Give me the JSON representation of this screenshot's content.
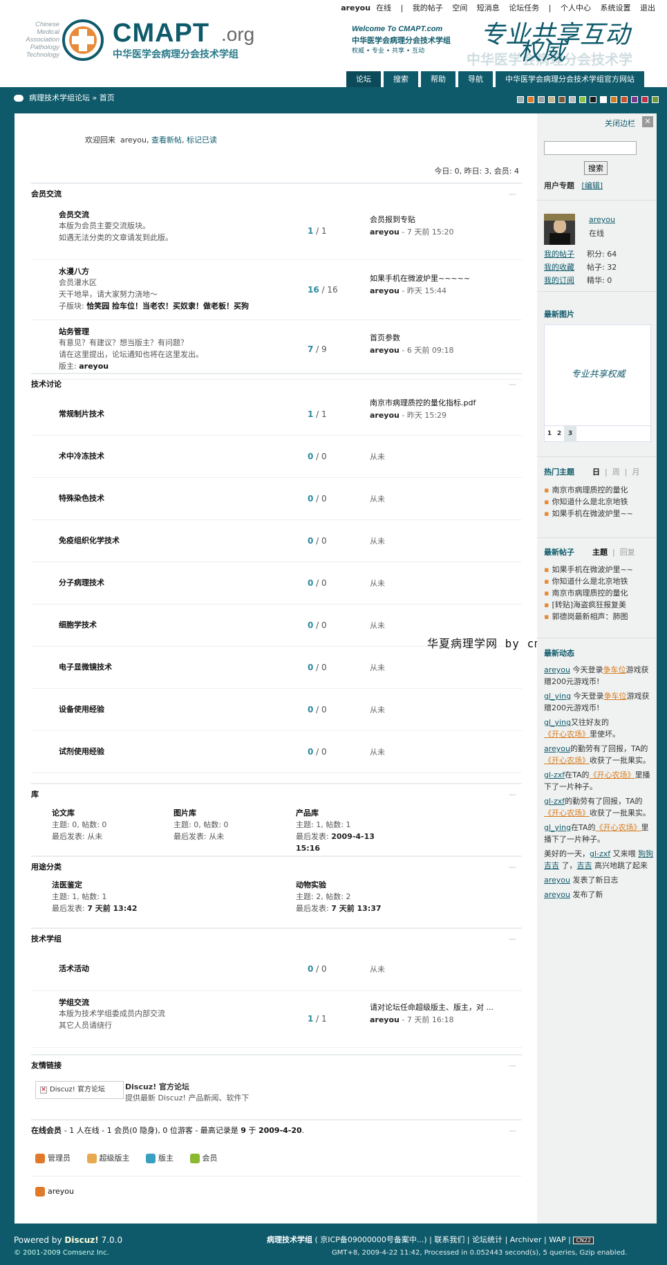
{
  "header": {
    "username": "areyou",
    "status": "在线",
    "sep": "|",
    "links": [
      "我的帖子",
      "空间",
      "短消息",
      "论坛任务",
      "个人中心",
      "系统设置",
      "退出"
    ],
    "logo_side": [
      "Chinese",
      "Medical",
      "Association",
      "Pathology",
      "Technology"
    ],
    "logo_big": "CMAPT",
    "logo_org": ".org",
    "logo_cn": "中华医学会病理分会技术学组",
    "banner_welcome": "Welcome To CMAPT.com",
    "banner_cn": "中华医学会病理分会技术学组",
    "banner_motto": "权威 • 专业 • 共享 • 互动",
    "banner_slogan1": "专业共享互动",
    "banner_slogan2": "权威",
    "banner_ghost": "中华医学会病理分会技术学"
  },
  "nav": {
    "tabs": [
      "论坛",
      "搜索",
      "帮助",
      "导航"
    ],
    "site": "中华医学会病理分会技术学组官方网站"
  },
  "crumb": {
    "forum": "病理技术学组论坛",
    "sep": "»",
    "home": "首页"
  },
  "swatch_colors": [
    "#9fb1b7",
    "#e07a2a",
    "#9aa0a3",
    "#c9b48a",
    "#7c5a3a",
    "#b8bcc0",
    "#8ac04a",
    "#1a1a1a",
    "#ffffff",
    "#d67a1e",
    "#c8532a",
    "#7a3a8a",
    "#c0304a",
    "#6a9a3a"
  ],
  "main": {
    "welcome_pre": "欢迎回来",
    "welcome_user": "areyou,",
    "welcome_new": "查看新帖",
    "welcome_read": "标记已读",
    "stats": "今日: 0, 昨日: 3, 会员: 4",
    "collapse": "—",
    "groups": {
      "g1": "会员交流",
      "g2": "技术讨论",
      "g3": "库",
      "g4": "用途分类",
      "g5": "技术学组",
      "g6": "友情链接"
    },
    "forums1": [
      {
        "name": "会员交流",
        "desc1": "本版为会员主要交流版块。",
        "desc2": "如遇无法分类的文章请发到此版。",
        "t": "1",
        "p": "1",
        "last_title": "会员报到专贴",
        "last_by": "areyou",
        "last_time": "- 7 天前 15:20"
      },
      {
        "name": "水漫八方",
        "desc1": "会员灌水区",
        "desc2": "天干地旱，请大家努力浇地～",
        "desc3": "子版块:",
        "subs": "恰笑园  捡车位！当老农！买奴隶！做老板！买狗",
        "t": "16",
        "p": "16",
        "last_title": "如果手机在微波炉里~~~~~",
        "last_by": "areyou",
        "last_time": "- 昨天 15:44"
      },
      {
        "name": "站务管理",
        "desc1": "有意见？有建议？想当版主？有问题？",
        "desc2": "请在这里提出，论坛通知也将在这里发出。",
        "mod_label": "版主:",
        "mod": "areyou",
        "t": "7",
        "p": "9",
        "last_title": "首页参数",
        "last_by": "areyou",
        "last_time": "- 6 天前 09:18"
      }
    ],
    "forums2": [
      {
        "name": "常规制片技术",
        "t": "1",
        "p": "1",
        "last_title": "南京市病理质控的量化指标.pdf",
        "last_by": "areyou",
        "last_time": "- 昨天 15:29"
      },
      {
        "name": "术中冷冻技术",
        "t": "0",
        "p": "0",
        "never": "从未"
      },
      {
        "name": "特殊染色技术",
        "t": "0",
        "p": "0",
        "never": "从未"
      },
      {
        "name": "免疫组织化学技术",
        "t": "0",
        "p": "0",
        "never": "从未"
      },
      {
        "name": "分子病理技术",
        "t": "0",
        "p": "0",
        "never": "从未"
      },
      {
        "name": "细胞学技术",
        "t": "0",
        "p": "0",
        "never": "从未"
      },
      {
        "name": "电子显微镜技术",
        "t": "0",
        "p": "0",
        "never": "从未"
      },
      {
        "name": "设备使用经验",
        "t": "0",
        "p": "0",
        "never": "从未"
      },
      {
        "name": "试剂使用经验",
        "t": "0",
        "p": "0",
        "never": "从未"
      }
    ],
    "libs": [
      {
        "name": "论文库",
        "stat": "主题: 0, 帖数: 0",
        "last": "最后发表: 从未"
      },
      {
        "name": "图片库",
        "stat": "主题: 0, 帖数: 0",
        "last": "最后发表: 从未"
      },
      {
        "name": "产品库",
        "stat": "主题: 1, 帖数: 1",
        "last_label": "最后发表:",
        "last_val": "2009-4-13",
        "last_val2": "15:16"
      }
    ],
    "uses": [
      {
        "name": "法医鉴定",
        "stat": "主题: 1, 帖数: 1",
        "last_label": "最后发表:",
        "last_val": "7 天前 13:42"
      },
      {
        "name": "动物实验",
        "stat": "主题: 2, 帖数: 2",
        "last_label": "最后发表:",
        "last_val": "7 天前 13:37"
      }
    ],
    "forums5": [
      {
        "name": "活术活动",
        "t": "0",
        "p": "0",
        "never": "从未"
      },
      {
        "name": "学组交流",
        "desc1": "本版为技术学组委成员内部交流",
        "desc2": "其它人员请绕行",
        "t": "1",
        "p": "1",
        "last_title": "请对论坛任命超级版主、版主，对 ...",
        "last_by": "areyou",
        "last_time": "- 7 天前 16:18"
      }
    ],
    "link": {
      "img_label": "Discuz! 官方论坛",
      "title": "Discuz! 官方论坛",
      "desc": "提供最新 Discuz! 产品新闻、软件下"
    },
    "online": {
      "label": "在线会员",
      "summary1": "- 1 人在线 - 1 会员(0 隐身), 0 位游客 - 最高记录是",
      "peak": "9",
      "summary2": "于",
      "peak_date": "2009-4-20",
      "summary3": ".",
      "legend": [
        "管理员",
        "超级版主",
        "版主",
        "会员"
      ],
      "legend_colors": [
        "#e07a2a",
        "#e8a850",
        "#3aa0c0",
        "#8ab830"
      ],
      "user": "areyou"
    }
  },
  "watermark": "华夏病理学网 by cmapt",
  "side": {
    "close": "关闭边栏",
    "close_x": "✕",
    "search_btn": "搜索",
    "topics_label": "用户专题",
    "topics_edit": "[编辑]",
    "user": "areyou",
    "user_status": "在线",
    "my_links": [
      "我的帖子",
      "我的收藏",
      "我的订阅"
    ],
    "user_stats": [
      "积分: 64",
      "帖子: 32",
      "精华: 0"
    ],
    "latest_img_title": "最新图片",
    "img_caption": "专业共享权威",
    "img_pages": [
      "1",
      "2",
      "3"
    ],
    "hot_title": "热门主题",
    "hot_tabs": [
      "日",
      "周",
      "月"
    ],
    "hot_list": [
      "南京市病理质控的量化",
      "你知道什么是北京地铁",
      "如果手机在微波炉里~~"
    ],
    "new_posts_title": "最新帖子",
    "new_posts_tabs": [
      "主题",
      "回复"
    ],
    "new_posts": [
      "如果手机在微波炉里~~",
      "你知道什么是北京地铁",
      "南京市病理质控的量化",
      "[转贴]海盗疯狂报复美",
      "郭德岗最新相声：肺图"
    ],
    "feed_title": "最新动态",
    "feed": [
      {
        "u": "areyou",
        "t1": " 今天登录",
        "l": "争车位",
        "t2": "游戏获赠200元游戏币!"
      },
      {
        "u": "gl_ying",
        "t1": " 今天登录",
        "l": "争车位",
        "t2": "游戏获赠200元游戏币!"
      },
      {
        "u": "gl_ying",
        "t1": "又往好友的",
        "l": "《开心农场》",
        "t2": "里使坏。"
      },
      {
        "u": "areyou",
        "t1": "的勤劳有了回报，TA的",
        "l": "《开心农场》",
        "t2": "收获了一批果实。"
      },
      {
        "u": "gl-zxf",
        "t1": "在TA的",
        "l": "《开心农场》",
        "t2": "里播下了一片种子。"
      },
      {
        "u": "gl-zxf",
        "t1": "的勤劳有了回报，TA的",
        "l": "《开心农场》",
        "t2": "收获了一批果实。"
      },
      {
        "u": "gl_ying",
        "t1": "在TA的",
        "l": "《开心农场》",
        "t2": "里播下了一片种子。"
      }
    ],
    "feed_pet": {
      "t1": "美好的一天，",
      "u": "gl-zxf",
      "t2": " 又来喂 ",
      "l1": "狗狗 吉吉",
      "t3": " 了，",
      "l2": "吉吉",
      "t4": " 高兴地跳了起来"
    },
    "feed_tail": [
      {
        "u": "areyou",
        "t": " 发表了新日志"
      },
      {
        "u": "areyou",
        "t": " 发布了新"
      }
    ]
  },
  "footer": {
    "powered": "Powered by",
    "brand": "Discuz!",
    "ver": "7.0.0",
    "copy": "© 2001-2009 Comsenz Inc.",
    "site": "病理技术学组",
    "icp": "( 京ICP备09000000号备案中...)",
    "links": [
      "联系我们",
      "论坛统计",
      "Archiver",
      "WAP"
    ],
    "sep": "|",
    "badge": "CN22",
    "info": "GMT+8, 2009-4-22 11:42, Processed in 0.052443 second(s), 5 queries, Gzip enabled."
  }
}
